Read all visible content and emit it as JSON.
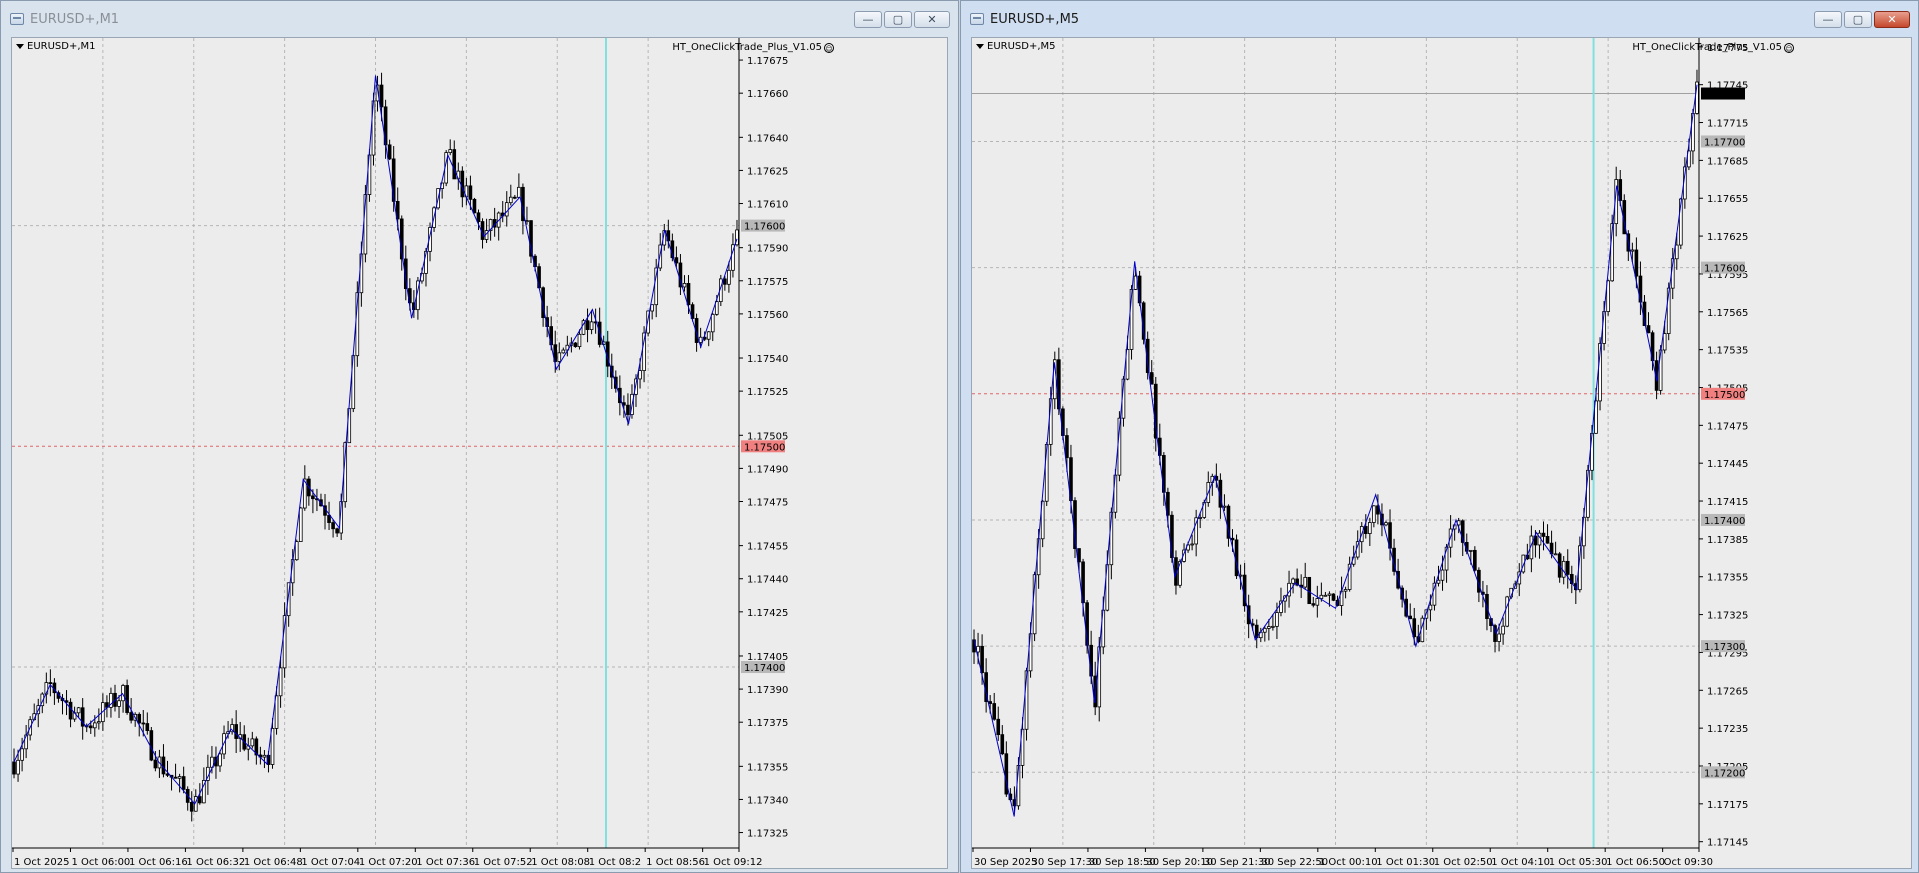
{
  "windows": [
    {
      "title": "EURUSD+,M1",
      "symbol_label": "EURUSD+,M1",
      "ea_label": "HT_OneClickTrade_Plus_V1.05",
      "controls": {
        "minimize": "—",
        "maximize": "▢",
        "close": "✕"
      },
      "price_axis": [
        "1.17675",
        "1.17660",
        "1.17640",
        "1.17625",
        "1.17610",
        "1.17590",
        "1.17575",
        "1.17560",
        "1.17540",
        "1.17525",
        "1.17505",
        "1.17490",
        "1.17475",
        "1.17455",
        "1.17440",
        "1.17425",
        "1.17405",
        "1.17390",
        "1.17375",
        "1.17355",
        "1.17340",
        "1.17325"
      ],
      "price_tags": [
        {
          "label": "1.17600",
          "kind": "level",
          "color": "#b8b8b8"
        },
        {
          "label": "1.17500",
          "kind": "entry",
          "color": "#f08080"
        },
        {
          "label": "1.17400",
          "kind": "level",
          "color": "#b8b8b8"
        }
      ],
      "time_axis": [
        "1 Oct 2025",
        "1 Oct 06:00",
        "1 Oct 06:16",
        "1 Oct 06:32",
        "1 Oct 06:48",
        "1 Oct 07:04",
        "1 Oct 07:20",
        "1 Oct 07:36",
        "1 Oct 07:52",
        "1 Oct 08:08",
        "1 Oct 08:2",
        "1 Oct 08:56",
        "1 Oct 09:12"
      ],
      "zigzag": [
        1.17357,
        1.17392,
        1.17373,
        1.17388,
        1.17357,
        1.17338,
        1.17372,
        1.17356,
        1.17485,
        1.17463,
        1.17668,
        1.17558,
        1.17632,
        1.17595,
        1.17613,
        1.17535,
        1.17562,
        1.1751,
        1.17598,
        1.17545,
        1.17594
      ],
      "price_min": 1.17318,
      "price_max": 1.17685,
      "colors": {
        "background": "#ececec",
        "candle": "#000000",
        "zigzag": "#0000cc",
        "grid": "#b5b5b5",
        "entry_line": "#e06666",
        "vline": "#7fe0e0"
      }
    },
    {
      "title": "EURUSD+,M5",
      "symbol_label": "EURUSD+,M5",
      "ea_label": "HT_OneClickTrade_Plus_V1.05",
      "controls": {
        "minimize": "—",
        "maximize": "▢",
        "close": "✕"
      },
      "price_axis": [
        "1.17775",
        "1.17745",
        "1.17715",
        "1.17685",
        "1.17655",
        "1.17625",
        "1.17595",
        "1.17565",
        "1.17535",
        "1.17505",
        "1.17475",
        "1.17445",
        "1.17415",
        "1.17385",
        "1.17355",
        "1.17325",
        "1.17295",
        "1.17265",
        "1.17235",
        "1.17205",
        "1.17175",
        "1.17145"
      ],
      "price_tags": [
        {
          "label": "1.17738",
          "kind": "current",
          "color": "#000000"
        },
        {
          "label": "1.17700",
          "kind": "level",
          "color": "#b8b8b8"
        },
        {
          "label": "1.17600",
          "kind": "level",
          "color": "#b8b8b8"
        },
        {
          "label": "1.17500",
          "kind": "entry",
          "color": "#f08080"
        },
        {
          "label": "1.17400",
          "kind": "level",
          "color": "#b8b8b8"
        },
        {
          "label": "1.17300",
          "kind": "level",
          "color": "#b8b8b8"
        },
        {
          "label": "1.17200",
          "kind": "level",
          "color": "#b8b8b8"
        }
      ],
      "time_axis": [
        "30 Sep 2025",
        "30 Sep 17:30",
        "30 Sep 18:50",
        "30 Sep 20:10",
        "30 Sep 21:30",
        "30 Sep 22:50",
        "1 Oct 00:10",
        "1 Oct 01:30",
        "1 Oct 02:50",
        "1 Oct 04:10",
        "1 Oct 05:30",
        "1 Oct 06:50",
        "Oct 09:30"
      ],
      "zigzag": [
        1.17305,
        1.17165,
        1.17525,
        1.17255,
        1.17605,
        1.17355,
        1.17435,
        1.17305,
        1.1735,
        1.1733,
        1.1742,
        1.173,
        1.174,
        1.1731,
        1.1739,
        1.17345,
        1.17665,
        1.1751,
        1.17745
      ],
      "price_min": 1.1714,
      "price_max": 1.17782,
      "colors": {
        "background": "#ececec",
        "candle": "#000000",
        "zigzag": "#0000cc",
        "grid": "#b5b5b5",
        "entry_line": "#e06666",
        "vline": "#7fe0e0",
        "current_price_line": "#a0a0a0"
      }
    }
  ]
}
